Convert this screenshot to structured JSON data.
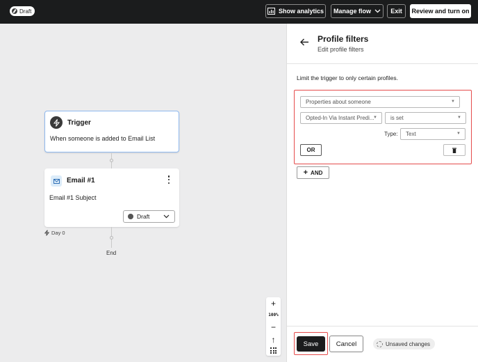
{
  "topbar": {
    "status_badge": "Draft",
    "show_analytics": "Show analytics",
    "manage_flow": "Manage flow",
    "exit": "Exit",
    "review": "Review and turn on"
  },
  "canvas": {
    "trigger": {
      "title": "Trigger",
      "description": "When someone is added to Email List"
    },
    "email": {
      "title": "Email #1",
      "subject": "Email #1 Subject",
      "status": "Draft"
    },
    "day_label": "Day 0",
    "end_label": "End",
    "zoom": {
      "level": "100%"
    }
  },
  "panel": {
    "title": "Profile filters",
    "subtitle": "Edit profile filters",
    "description": "Limit the trigger to only certain profiles.",
    "filter": {
      "condition_type": "Properties about someone",
      "property": "Opted-In Via Instant Predi...",
      "operator": "is set",
      "type_label": "Type:",
      "type_value": "Text",
      "or_label": "OR"
    },
    "and_label": "AND",
    "save": "Save",
    "cancel": "Cancel",
    "unsaved": "Unsaved changes"
  },
  "icons": {
    "status": "draft-pencil-icon",
    "analytics": "bar-chart-icon",
    "trigger": "lightning-icon",
    "email": "envelope-icon",
    "back": "arrow-left-icon",
    "delete": "trash-icon"
  },
  "colors": {
    "topbar": "#1b1c1d",
    "highlight": "#e54b4b",
    "trigger_border": "#8fb9ef"
  }
}
